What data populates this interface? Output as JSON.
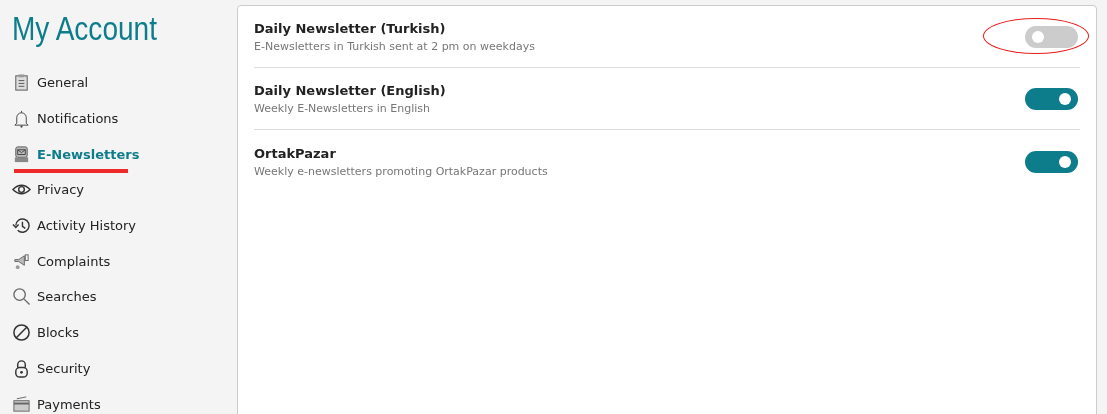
{
  "sidebar": {
    "title": "My Account",
    "items": [
      {
        "label": "General",
        "selected": false
      },
      {
        "label": "Notifications",
        "selected": false
      },
      {
        "label": "E-Newsletters",
        "selected": true
      },
      {
        "label": "Privacy",
        "selected": false
      },
      {
        "label": "Activity History",
        "selected": false
      },
      {
        "label": "Complaints",
        "selected": false
      },
      {
        "label": "Searches",
        "selected": false
      },
      {
        "label": "Blocks",
        "selected": false
      },
      {
        "label": "Security",
        "selected": false
      },
      {
        "label": "Payments",
        "selected": false
      }
    ]
  },
  "newsletters": [
    {
      "title": "Daily Newsletter (Turkish)",
      "description": "E-Newsletters in Turkish sent at 2 pm on weekdays",
      "on": false,
      "highlighted": true
    },
    {
      "title": "Daily Newsletter (English)",
      "description": "Weekly E-Newsletters in English",
      "on": true,
      "highlighted": false
    },
    {
      "title": "OrtakPazar",
      "description": "Weekly e-newsletters promoting OrtakPazar products",
      "on": true,
      "highlighted": false
    }
  ]
}
